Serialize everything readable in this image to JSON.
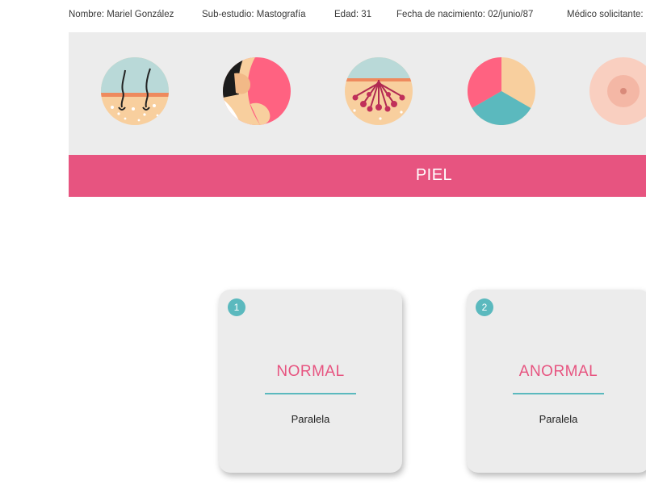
{
  "patient": {
    "name": "Nombre: Mariel González",
    "substudy": "Sub-estudio: Mastografía",
    "age": "Edad: 31",
    "birthdate": "Fecha de nacimiento: 02/junio/87",
    "doctor": "Médico solicitante:"
  },
  "categories": [
    {
      "icon": "skin-hair-follicle-icon"
    },
    {
      "icon": "breast-profile-icon"
    },
    {
      "icon": "mammary-gland-icon"
    },
    {
      "icon": "breast-density-pie-icon"
    },
    {
      "icon": "nipple-areola-icon"
    }
  ],
  "section": {
    "title": "PIEL"
  },
  "options": [
    {
      "number": "1",
      "title": "NORMAL",
      "subtitle": "Paralela"
    },
    {
      "number": "2",
      "title": "ANORMAL",
      "subtitle": "Paralela"
    }
  ],
  "colors": {
    "accent_pink": "#e75480",
    "accent_teal": "#5bb9be",
    "panel_gray": "#ececec",
    "skin_peach": "#f8cf9e"
  }
}
